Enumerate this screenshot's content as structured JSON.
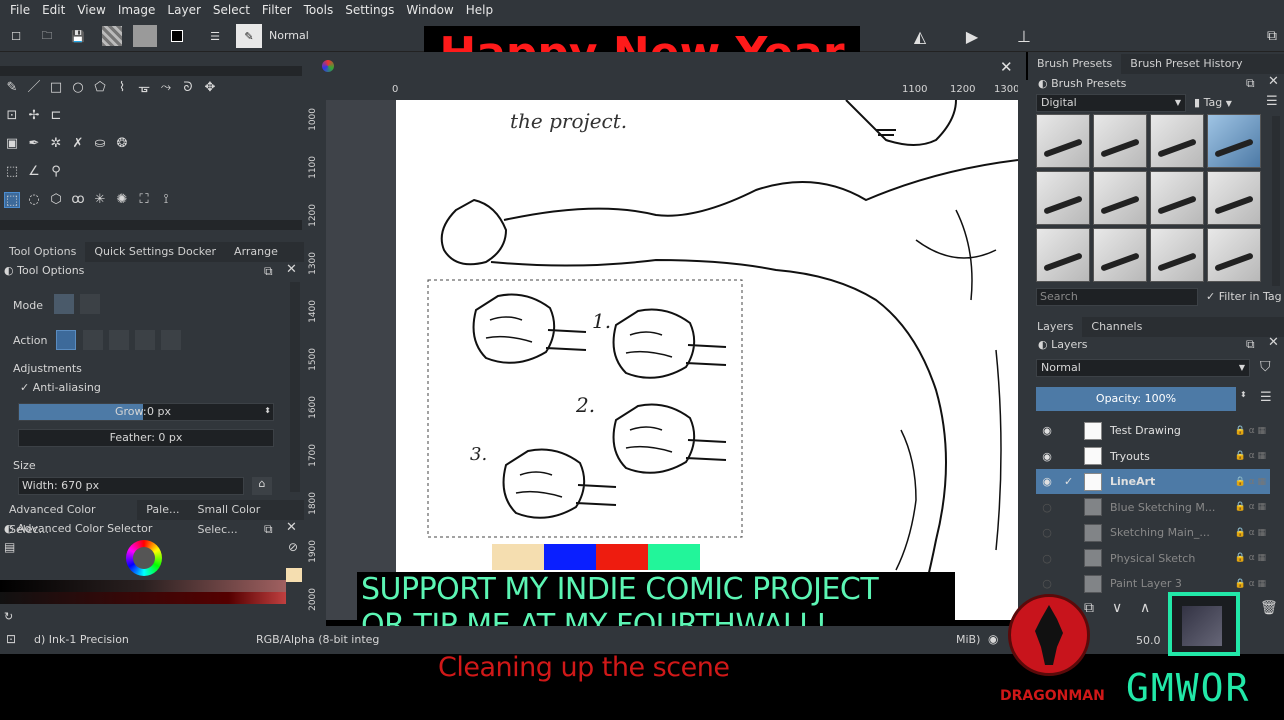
{
  "menu": [
    "File",
    "Edit",
    "View",
    "Image",
    "Layer",
    "Select",
    "Filter",
    "Tools",
    "Settings",
    "Window",
    "Help"
  ],
  "toolbar": {
    "blend_mode": "Normal"
  },
  "overlays": {
    "banner": "Happy New Year",
    "support_line1": "SUPPORT MY INDIE COMIC PROJECT",
    "support_line2": "OR TIP ME AT MY FOURTHWALL!",
    "caption": "Cleaning up the scene",
    "logo_left": "DRAGONMAN",
    "logo_right": "GMWOR"
  },
  "ruler": {
    "h_ticks": [
      "0",
      "1100",
      "1200",
      "1300"
    ],
    "v_ticks": [
      "1000",
      "1100",
      "1200",
      "1300",
      "1400",
      "1500",
      "1600",
      "1700",
      "1800",
      "1900",
      "2000"
    ]
  },
  "dock_tabs": [
    "Tool Options",
    "Quick Settings Docker",
    "Arrange"
  ],
  "tool_options": {
    "title": "Tool Options",
    "mode_label": "Mode",
    "action_label": "Action",
    "adjustments_label": "Adjustments",
    "antialias_label": "Anti-aliasing",
    "grow_label": "Grow:",
    "grow_value": "0 px",
    "feather": "Feather: 0 px",
    "size_label": "Size",
    "width": "Width: 670 px"
  },
  "color_tabs": [
    "Advanced Color Selec...",
    "Pale...",
    "Small Color Selec..."
  ],
  "color_selector_title": "Advanced Color Selector",
  "brush_tabs": [
    "Brush Presets",
    "Brush Preset History"
  ],
  "brush_presets": {
    "title": "Brush Presets",
    "category": "Digital",
    "tag_label": "Tag",
    "search_placeholder": "Search",
    "filter_label": "Filter in Tag"
  },
  "layer_tabs": [
    "Layers",
    "Channels"
  ],
  "layers_panel": {
    "title": "Layers",
    "blend": "Normal",
    "opacity": "Opacity: 100%",
    "items": [
      {
        "name": "Test Drawing",
        "visible": true
      },
      {
        "name": "Tryouts",
        "visible": true
      },
      {
        "name": "LineArt",
        "visible": true,
        "selected": true
      },
      {
        "name": "Blue Sketching M...",
        "visible": false
      },
      {
        "name": "Sketching Main_...",
        "visible": false
      },
      {
        "name": "Physical Sketch",
        "visible": false
      },
      {
        "name": "Paint Layer 3",
        "visible": false
      }
    ]
  },
  "status": {
    "brush": "d) Ink-1 Precision",
    "color_space": "RGB/Alpha (8-bit integ",
    "mem": "MiB)",
    "zoom": "50.0"
  },
  "sketch_labels": [
    "the project.",
    "1.",
    "2.",
    "3."
  ],
  "swatches": [
    "#f5deb0",
    "#0a1fff",
    "#ee1c0f",
    "#22f59a"
  ]
}
